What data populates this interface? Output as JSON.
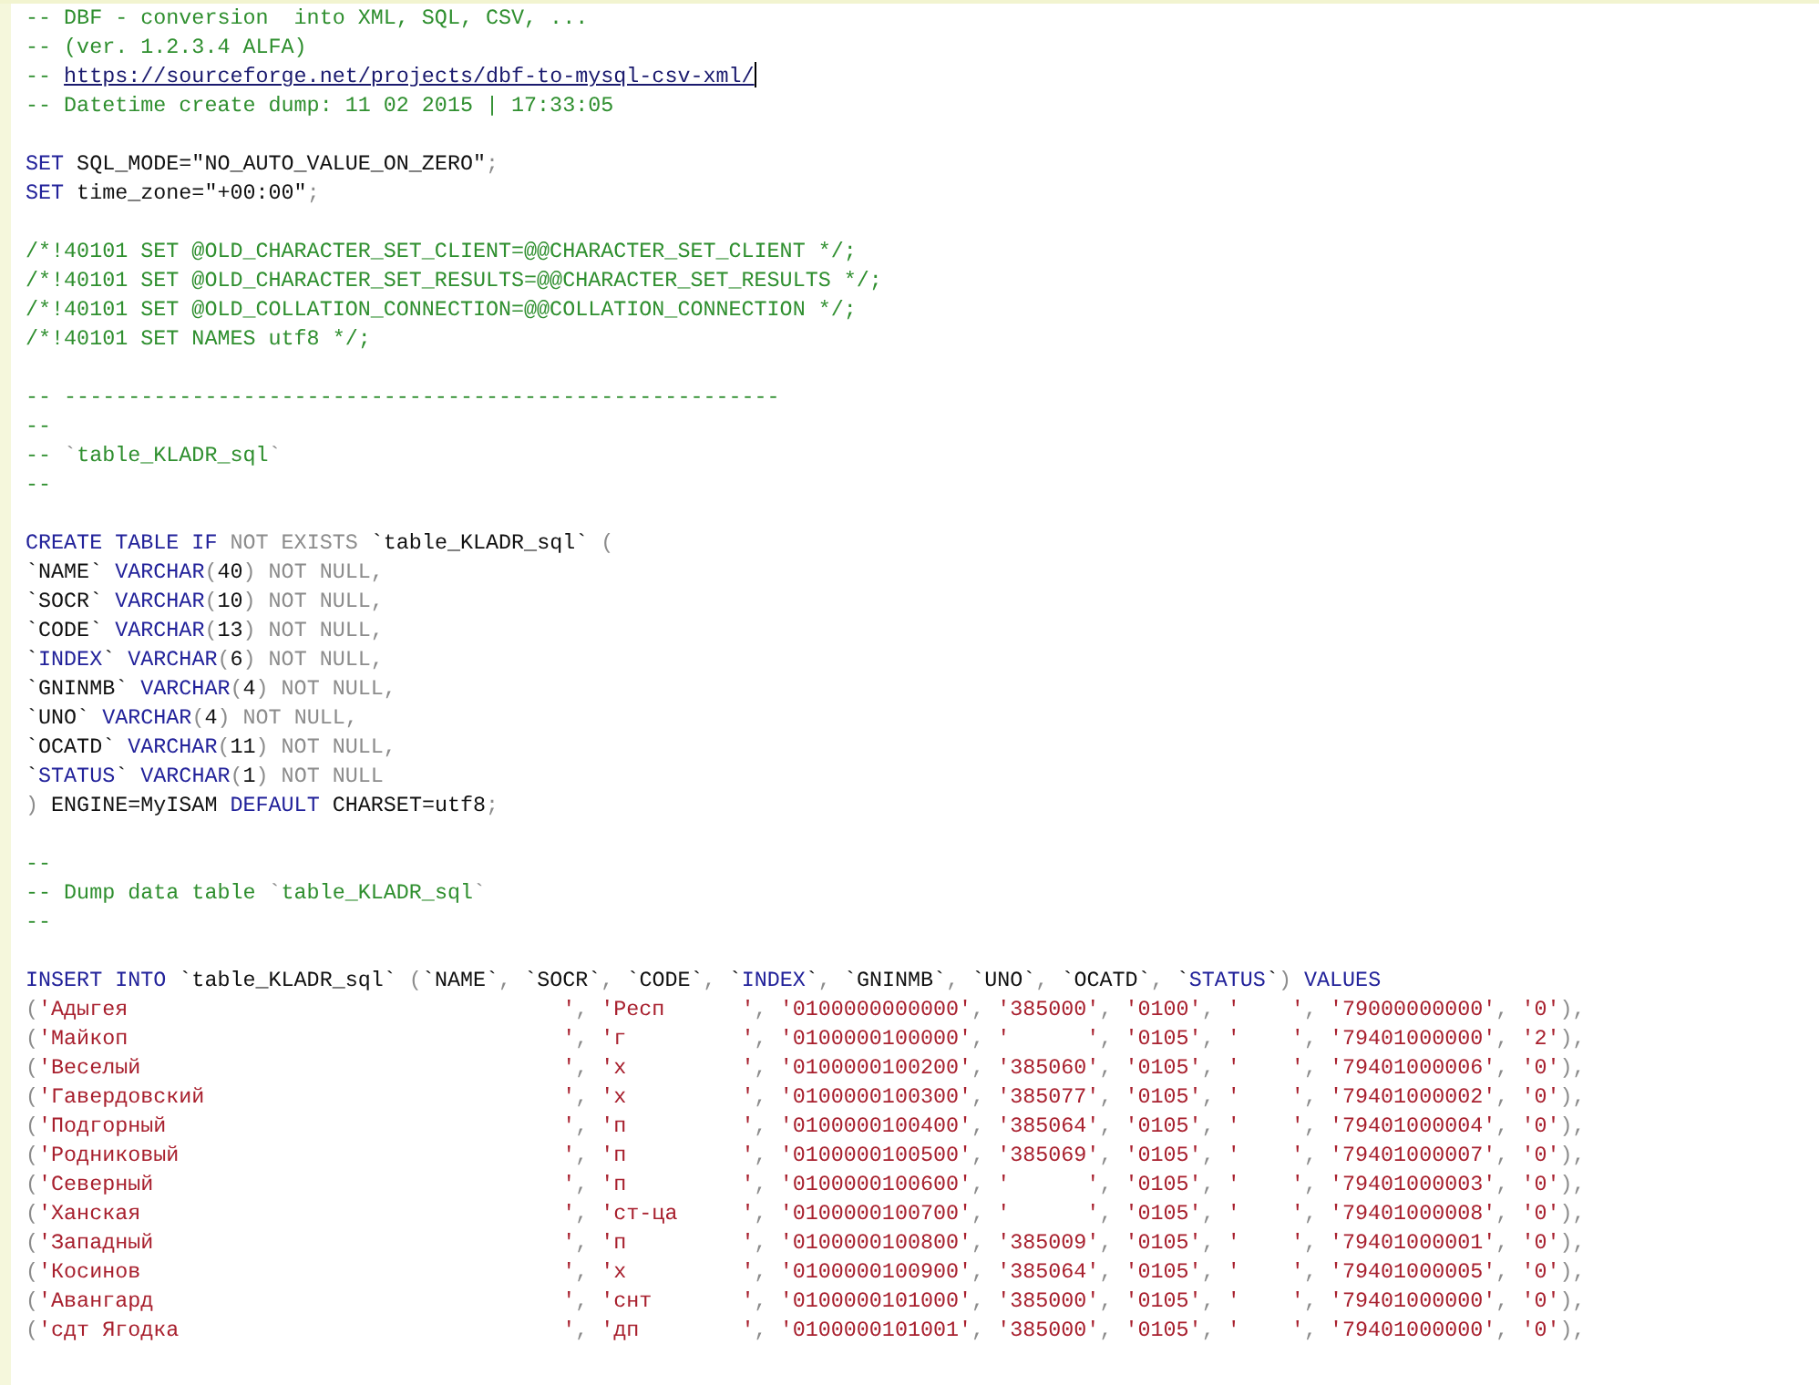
{
  "editor": {
    "blocks": [
      {
        "lines": [
          {
            "tokens": [
              {
                "kind": "comment",
                "text": "-- DBF - conversion  into XML, SQL, CSV, ..."
              }
            ]
          },
          {
            "tokens": [
              {
                "kind": "comment",
                "text": "-- (ver. 1.2.3.4 ALFA)"
              }
            ]
          },
          {
            "tokens": [
              {
                "kind": "comment",
                "text": "-- "
              },
              {
                "kind": "link",
                "text": "https://sourceforge.net/projects/dbf-to-mysql-csv-xml/",
                "caret": true
              }
            ]
          },
          {
            "tokens": [
              {
                "kind": "comment",
                "text": "-- Datetime create dump: 11 02 2015 | 17:33:05"
              }
            ]
          }
        ]
      },
      {
        "lines": [
          {
            "tokens": [
              {
                "kind": "keyword",
                "text": "SET"
              },
              {
                "kind": "plain",
                "text": " SQL_MODE=\"NO_AUTO_VALUE_ON_ZERO\""
              },
              {
                "kind": "punct",
                "text": ";"
              }
            ]
          },
          {
            "tokens": [
              {
                "kind": "keyword",
                "text": "SET"
              },
              {
                "kind": "plain",
                "text": " time_zone=\"+00:00\""
              },
              {
                "kind": "punct",
                "text": ";"
              }
            ]
          }
        ]
      },
      {
        "lines": [
          {
            "tokens": [
              {
                "kind": "comment",
                "text": "/*!40101 SET @OLD_CHARACTER_SET_CLIENT=@@CHARACTER_SET_CLIENT */;"
              }
            ]
          },
          {
            "tokens": [
              {
                "kind": "comment",
                "text": "/*!40101 SET @OLD_CHARACTER_SET_RESULTS=@@CHARACTER_SET_RESULTS */;"
              }
            ]
          },
          {
            "tokens": [
              {
                "kind": "comment",
                "text": "/*!40101 SET @OLD_COLLATION_CONNECTION=@@COLLATION_CONNECTION */;"
              }
            ]
          },
          {
            "tokens": [
              {
                "kind": "comment",
                "text": "/*!40101 SET NAMES utf8 */;"
              }
            ]
          }
        ]
      },
      {
        "lines": [
          {
            "tokens": [
              {
                "kind": "comment",
                "text": "-- --------------------------------------------------------"
              }
            ]
          },
          {
            "tokens": [
              {
                "kind": "comment",
                "text": "--"
              }
            ]
          },
          {
            "tokens": [
              {
                "kind": "comment",
                "text": "-- "
              },
              {
                "kind": "punct",
                "text": "`"
              },
              {
                "kind": "comment",
                "text": "table_KLADR_sql"
              },
              {
                "kind": "punct",
                "text": "`"
              }
            ]
          },
          {
            "tokens": [
              {
                "kind": "comment",
                "text": "--"
              }
            ]
          }
        ]
      },
      {
        "lines": [
          {
            "tokens": [
              {
                "kind": "keyword",
                "text": "CREATE TABLE IF"
              },
              {
                "kind": "punct",
                "text": " NOT EXISTS "
              },
              {
                "kind": "plain",
                "text": "`table_KLADR_sql`"
              },
              {
                "kind": "punct",
                "text": " ("
              }
            ]
          },
          {
            "tokens": [
              {
                "kind": "plain",
                "text": "`NAME` "
              },
              {
                "kind": "keyword",
                "text": "VARCHAR"
              },
              {
                "kind": "punct",
                "text": "("
              },
              {
                "kind": "plain",
                "text": "40"
              },
              {
                "kind": "punct",
                "text": ") NOT NULL,"
              }
            ]
          },
          {
            "tokens": [
              {
                "kind": "plain",
                "text": "`SOCR` "
              },
              {
                "kind": "keyword",
                "text": "VARCHAR"
              },
              {
                "kind": "punct",
                "text": "("
              },
              {
                "kind": "plain",
                "text": "10"
              },
              {
                "kind": "punct",
                "text": ") NOT NULL,"
              }
            ]
          },
          {
            "tokens": [
              {
                "kind": "plain",
                "text": "`CODE` "
              },
              {
                "kind": "keyword",
                "text": "VARCHAR"
              },
              {
                "kind": "punct",
                "text": "("
              },
              {
                "kind": "plain",
                "text": "13"
              },
              {
                "kind": "punct",
                "text": ") NOT NULL,"
              }
            ]
          },
          {
            "tokens": [
              {
                "kind": "plain",
                "text": "`"
              },
              {
                "kind": "keyword",
                "text": "INDEX"
              },
              {
                "kind": "plain",
                "text": "` "
              },
              {
                "kind": "keyword",
                "text": "VARCHAR"
              },
              {
                "kind": "punct",
                "text": "("
              },
              {
                "kind": "plain",
                "text": "6"
              },
              {
                "kind": "punct",
                "text": ") NOT NULL,"
              }
            ]
          },
          {
            "tokens": [
              {
                "kind": "plain",
                "text": "`GNINMB` "
              },
              {
                "kind": "keyword",
                "text": "VARCHAR"
              },
              {
                "kind": "punct",
                "text": "("
              },
              {
                "kind": "plain",
                "text": "4"
              },
              {
                "kind": "punct",
                "text": ") NOT NULL,"
              }
            ]
          },
          {
            "tokens": [
              {
                "kind": "plain",
                "text": "`UNO` "
              },
              {
                "kind": "keyword",
                "text": "VARCHAR"
              },
              {
                "kind": "punct",
                "text": "("
              },
              {
                "kind": "plain",
                "text": "4"
              },
              {
                "kind": "punct",
                "text": ") NOT NULL,"
              }
            ]
          },
          {
            "tokens": [
              {
                "kind": "plain",
                "text": "`OCATD` "
              },
              {
                "kind": "keyword",
                "text": "VARCHAR"
              },
              {
                "kind": "punct",
                "text": "("
              },
              {
                "kind": "plain",
                "text": "11"
              },
              {
                "kind": "punct",
                "text": ") NOT NULL,"
              }
            ]
          },
          {
            "tokens": [
              {
                "kind": "plain",
                "text": "`"
              },
              {
                "kind": "keyword",
                "text": "STATUS"
              },
              {
                "kind": "plain",
                "text": "` "
              },
              {
                "kind": "keyword",
                "text": "VARCHAR"
              },
              {
                "kind": "punct",
                "text": "("
              },
              {
                "kind": "plain",
                "text": "1"
              },
              {
                "kind": "punct",
                "text": ") NOT NULL"
              }
            ]
          },
          {
            "tokens": [
              {
                "kind": "punct",
                "text": ")"
              },
              {
                "kind": "plain",
                "text": " ENGINE=MyISAM "
              },
              {
                "kind": "keyword",
                "text": "DEFAULT"
              },
              {
                "kind": "plain",
                "text": " CHARSET=utf8"
              },
              {
                "kind": "punct",
                "text": ";"
              }
            ]
          }
        ]
      },
      {
        "lines": [
          {
            "tokens": [
              {
                "kind": "comment",
                "text": "--"
              }
            ]
          },
          {
            "tokens": [
              {
                "kind": "comment",
                "text": "-- Dump data table "
              },
              {
                "kind": "punct",
                "text": "`"
              },
              {
                "kind": "comment",
                "text": "table_KLADR_sql"
              },
              {
                "kind": "punct",
                "text": "`"
              }
            ]
          },
          {
            "tokens": [
              {
                "kind": "comment",
                "text": "--"
              }
            ]
          }
        ]
      },
      {
        "lines": [
          {
            "tokens": [
              {
                "kind": "keyword",
                "text": "INSERT INTO"
              },
              {
                "kind": "plain",
                "text": " `table_KLADR_sql` "
              },
              {
                "kind": "punct",
                "text": "("
              },
              {
                "kind": "plain",
                "text": "`NAME`"
              },
              {
                "kind": "punct",
                "text": ", "
              },
              {
                "kind": "plain",
                "text": "`SOCR`"
              },
              {
                "kind": "punct",
                "text": ", "
              },
              {
                "kind": "plain",
                "text": "`CODE`"
              },
              {
                "kind": "punct",
                "text": ", "
              },
              {
                "kind": "plain",
                "text": "`"
              },
              {
                "kind": "keyword",
                "text": "INDEX"
              },
              {
                "kind": "plain",
                "text": "`"
              },
              {
                "kind": "punct",
                "text": ", "
              },
              {
                "kind": "plain",
                "text": "`GNINMB`"
              },
              {
                "kind": "punct",
                "text": ", "
              },
              {
                "kind": "plain",
                "text": "`UNO`"
              },
              {
                "kind": "punct",
                "text": ", "
              },
              {
                "kind": "plain",
                "text": "`OCATD`"
              },
              {
                "kind": "punct",
                "text": ", "
              },
              {
                "kind": "plain",
                "text": "`"
              },
              {
                "kind": "keyword",
                "text": "STATUS"
              },
              {
                "kind": "plain",
                "text": "`"
              },
              {
                "kind": "punct",
                "text": ") "
              },
              {
                "kind": "keyword",
                "text": "VALUES"
              }
            ]
          }
        ],
        "rows": [
          [
            "(",
            "'Адыгея                                  '",
            ", ",
            "'Респ      '",
            ", ",
            "'0100000000000'",
            ", ",
            "'385000'",
            ", ",
            "'0100'",
            ", ",
            "'    '",
            ", ",
            "'79000000000'",
            ", ",
            "'0'",
            "),"
          ],
          [
            "(",
            "'Майкоп                                  '",
            ", ",
            "'г         '",
            ", ",
            "'0100000100000'",
            ", ",
            "'      '",
            ", ",
            "'0105'",
            ", ",
            "'    '",
            ", ",
            "'79401000000'",
            ", ",
            "'2'",
            "),"
          ],
          [
            "(",
            "'Веселый                                 '",
            ", ",
            "'х         '",
            ", ",
            "'0100000100200'",
            ", ",
            "'385060'",
            ", ",
            "'0105'",
            ", ",
            "'    '",
            ", ",
            "'79401000006'",
            ", ",
            "'0'",
            "),"
          ],
          [
            "(",
            "'Гавердовский                            '",
            ", ",
            "'х         '",
            ", ",
            "'0100000100300'",
            ", ",
            "'385077'",
            ", ",
            "'0105'",
            ", ",
            "'    '",
            ", ",
            "'79401000002'",
            ", ",
            "'0'",
            "),"
          ],
          [
            "(",
            "'Подгорный                               '",
            ", ",
            "'п         '",
            ", ",
            "'0100000100400'",
            ", ",
            "'385064'",
            ", ",
            "'0105'",
            ", ",
            "'    '",
            ", ",
            "'79401000004'",
            ", ",
            "'0'",
            "),"
          ],
          [
            "(",
            "'Родниковый                              '",
            ", ",
            "'п         '",
            ", ",
            "'0100000100500'",
            ", ",
            "'385069'",
            ", ",
            "'0105'",
            ", ",
            "'    '",
            ", ",
            "'79401000007'",
            ", ",
            "'0'",
            "),"
          ],
          [
            "(",
            "'Северный                                '",
            ", ",
            "'п         '",
            ", ",
            "'0100000100600'",
            ", ",
            "'      '",
            ", ",
            "'0105'",
            ", ",
            "'    '",
            ", ",
            "'79401000003'",
            ", ",
            "'0'",
            "),"
          ],
          [
            "(",
            "'Ханская                                 '",
            ", ",
            "'ст-ца     '",
            ", ",
            "'0100000100700'",
            ", ",
            "'      '",
            ", ",
            "'0105'",
            ", ",
            "'    '",
            ", ",
            "'79401000008'",
            ", ",
            "'0'",
            "),"
          ],
          [
            "(",
            "'Западный                                '",
            ", ",
            "'п         '",
            ", ",
            "'0100000100800'",
            ", ",
            "'385009'",
            ", ",
            "'0105'",
            ", ",
            "'    '",
            ", ",
            "'79401000001'",
            ", ",
            "'0'",
            "),"
          ],
          [
            "(",
            "'Косинов                                 '",
            ", ",
            "'х         '",
            ", ",
            "'0100000100900'",
            ", ",
            "'385064'",
            ", ",
            "'0105'",
            ", ",
            "'    '",
            ", ",
            "'79401000005'",
            ", ",
            "'0'",
            "),"
          ],
          [
            "(",
            "'Авангард                                '",
            ", ",
            "'снт       '",
            ", ",
            "'0100000101000'",
            ", ",
            "'385000'",
            ", ",
            "'0105'",
            ", ",
            "'    '",
            ", ",
            "'79401000000'",
            ", ",
            "'0'",
            "),"
          ],
          [
            "(",
            "'сдт Ягодка                              '",
            ", ",
            "'дп        '",
            ", ",
            "'0100000101001'",
            ", ",
            "'385000'",
            ", ",
            "'0105'",
            ", ",
            "'    '",
            ", ",
            "'79401000000'",
            ", ",
            "'0'",
            "),"
          ]
        ]
      }
    ]
  }
}
